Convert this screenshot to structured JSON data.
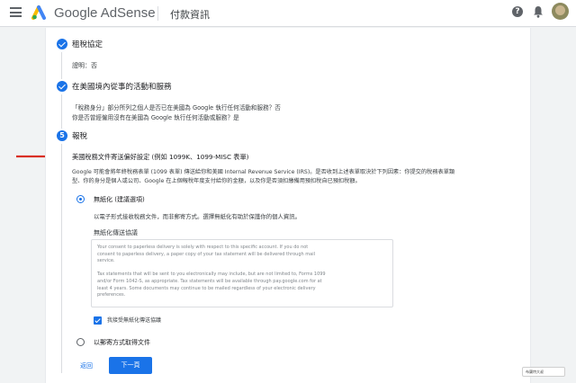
{
  "header": {
    "brand": "Google AdSense",
    "page_title": "付款資訊",
    "help_symbol": "?"
  },
  "steps": {
    "treaty": {
      "title": "租稅協定",
      "detail": "證明：否"
    },
    "us_activities": {
      "title": "在美國境內從事的活動和服務",
      "desc_line1": "「稅務身分」部分所列之個人是否已在美國為 Google 執行任何活動和服務？否",
      "desc_line2": "你是否曾經僱用沒有在美國為 Google 執行任何活動或服務？是"
    },
    "tax_report": {
      "number": "5",
      "title": "報稅",
      "subtitle": "美國稅務文件寄送偏好設定 (例如 1099K、1099-MISC 表單)",
      "desc_line1": "Google 可能會將年終稅務表單 (1099 表單) 傳送給你和美國 Internal Revenue Service (IRS)。是否收到上述表單取決於下列因素：你提交的稅務表單類",
      "desc_line2": "型、你的身分是個人或公司、Google 在上個報稅年度支付給你的金額，以及你是否須扣繳備用預扣稅自已預扣稅額。"
    }
  },
  "options": {
    "paperless": {
      "label": "無紙化 (建議選項)",
      "desc": "以電子形式接收稅務文件，而非郵寄方式。選擇無紙化有助於保護你的個人資訊。",
      "agreement_title": "無紙化傳送協議",
      "agreement_lines": [
        "Your consent to paperless delivery is solely with respect to this specific account. If you do not",
        "consent to paperless delivery, a paper copy of your tax statement will be delivered through mail",
        "service.",
        "",
        "Tax statements that will be sent to you electronically may include, but are not limited to, Forms 1099",
        "and/or Form 1042-S, as appropriate. Tax statements will be available through pay.google.com for at",
        "least 4 years. Some documents may continue to be mailed regardless of your electronic delivery",
        "preferences."
      ],
      "consent_label": "我接受無紙化傳送協議"
    },
    "mail": {
      "label": "以郵寄方式取得文件"
    }
  },
  "actions": {
    "back_label": "返回",
    "next_label": "下一頁"
  },
  "watermark_text": "布蘭特大叔",
  "colors": {
    "accent": "#1a73e8",
    "annotation_arrow": "#d93025",
    "background": "#f1f3f4"
  },
  "icons": {
    "menu": "menu-icon",
    "logo": "adsense-logo",
    "help": "help-icon",
    "notifications": "bell-icon",
    "step_done": "check-circle-icon",
    "consent": "checkbox-checked-icon"
  }
}
